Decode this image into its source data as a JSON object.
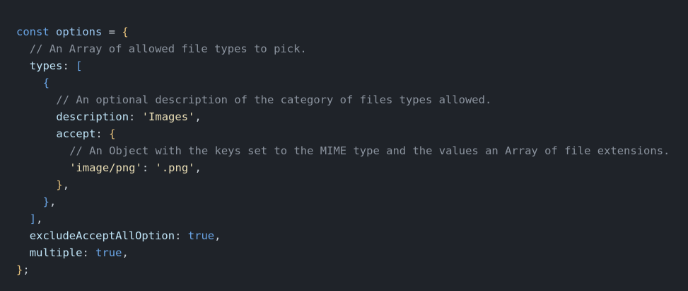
{
  "code_lines": [
    {
      "id": "l1",
      "tokens": [
        [
          "kw",
          "const"
        ],
        [
          "op",
          " "
        ],
        [
          "var",
          "options"
        ],
        [
          "op",
          " = "
        ],
        [
          "br",
          "{"
        ]
      ]
    },
    {
      "id": "l2",
      "tokens": [
        [
          "cm",
          "// An Array of allowed file types to pick."
        ]
      ]
    },
    {
      "id": "l3",
      "tokens": [
        [
          "prop",
          "types"
        ],
        [
          "pun",
          ": "
        ],
        [
          "brk",
          "["
        ]
      ]
    },
    {
      "id": "l4",
      "tokens": [
        [
          "brk",
          "{"
        ]
      ]
    },
    {
      "id": "l5",
      "tokens": [
        [
          "cm",
          "// An optional description of the category of files types allowed."
        ]
      ]
    },
    {
      "id": "l6",
      "tokens": [
        [
          "prop",
          "description"
        ],
        [
          "pun",
          ": "
        ],
        [
          "str",
          "'Images'"
        ],
        [
          "pun",
          ","
        ]
      ]
    },
    {
      "id": "l7",
      "tokens": [
        [
          "prop",
          "accept"
        ],
        [
          "pun",
          ": "
        ],
        [
          "br",
          "{"
        ]
      ]
    },
    {
      "id": "l8",
      "tokens": [
        [
          "cm",
          "// An Object with the keys set to the MIME type and the values an Array of file extensions."
        ]
      ]
    },
    {
      "id": "l9",
      "tokens": [
        [
          "str",
          "'image/png'"
        ],
        [
          "pun",
          ": "
        ],
        [
          "str",
          "'.png'"
        ],
        [
          "pun",
          ","
        ]
      ]
    },
    {
      "id": "l10",
      "tokens": [
        [
          "br",
          "}"
        ],
        [
          "pun",
          ","
        ]
      ]
    },
    {
      "id": "l11",
      "tokens": [
        [
          "brk",
          "}"
        ],
        [
          "pun",
          ","
        ]
      ]
    },
    {
      "id": "l12",
      "tokens": [
        [
          "brk",
          "]"
        ],
        [
          "pun",
          ","
        ]
      ]
    },
    {
      "id": "l13",
      "tokens": [
        [
          "prop",
          "excludeAcceptAllOption"
        ],
        [
          "pun",
          ": "
        ],
        [
          "bool",
          "true"
        ],
        [
          "pun",
          ","
        ]
      ]
    },
    {
      "id": "l14",
      "tokens": [
        [
          "prop",
          "multiple"
        ],
        [
          "pun",
          ": "
        ],
        [
          "bool",
          "true"
        ],
        [
          "pun",
          ","
        ]
      ]
    },
    {
      "id": "l15",
      "tokens": [
        [
          "br",
          "}"
        ],
        [
          "pun",
          ";"
        ]
      ]
    }
  ]
}
